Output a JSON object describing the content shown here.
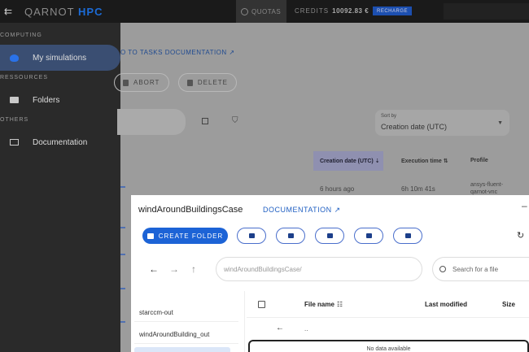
{
  "topbar": {
    "menu_icon": "menu-collapse-icon",
    "logo_prefix": "QARNOT",
    "logo_suffix": "HPC",
    "quotas_label": "QUOTAS",
    "credits_label": "CREDITS",
    "credits_value": "10092.83 €",
    "recharge_label": "RECHARGE"
  },
  "sidebar": {
    "sections": [
      "COMPUTING",
      "RESSOURCES",
      "OTHERS"
    ],
    "items": [
      {
        "label": "My simulations",
        "icon": "cloud-icon",
        "active": true
      },
      {
        "label": "Folders",
        "icon": "folder-icon",
        "active": false
      },
      {
        "label": "Documentation",
        "icon": "book-icon",
        "active": false
      }
    ]
  },
  "main": {
    "back_link": "O TO TASKS DOCUMENTATION ↗",
    "abort_label": "ABORT",
    "delete_label": "DELETE",
    "sort": {
      "label": "Sort by",
      "value": "Creation date (UTC)"
    },
    "table": {
      "headers": [
        "Creation date (UTC)",
        "Execution time",
        "Profile"
      ],
      "row": {
        "created": "6 hours ago",
        "exec": "6h 10m 41s",
        "profile": "ansys-fluent-qarnot-vnc"
      }
    }
  },
  "dialog": {
    "title": "windAroundBuildingsCase",
    "doc_link": "DOCUMENTATION ↗",
    "close": "–",
    "create_folder": "CREATE FOLDER",
    "path_value": "windAroundBuildingsCase/",
    "search_placeholder": "Search for a file",
    "tree": [
      "starccm-out",
      "windAroundBuilding_out"
    ],
    "headers": {
      "name": "File name",
      "modified": "Last modified",
      "size": "Size"
    },
    "parent_label": "..",
    "no_data": "No data available"
  }
}
